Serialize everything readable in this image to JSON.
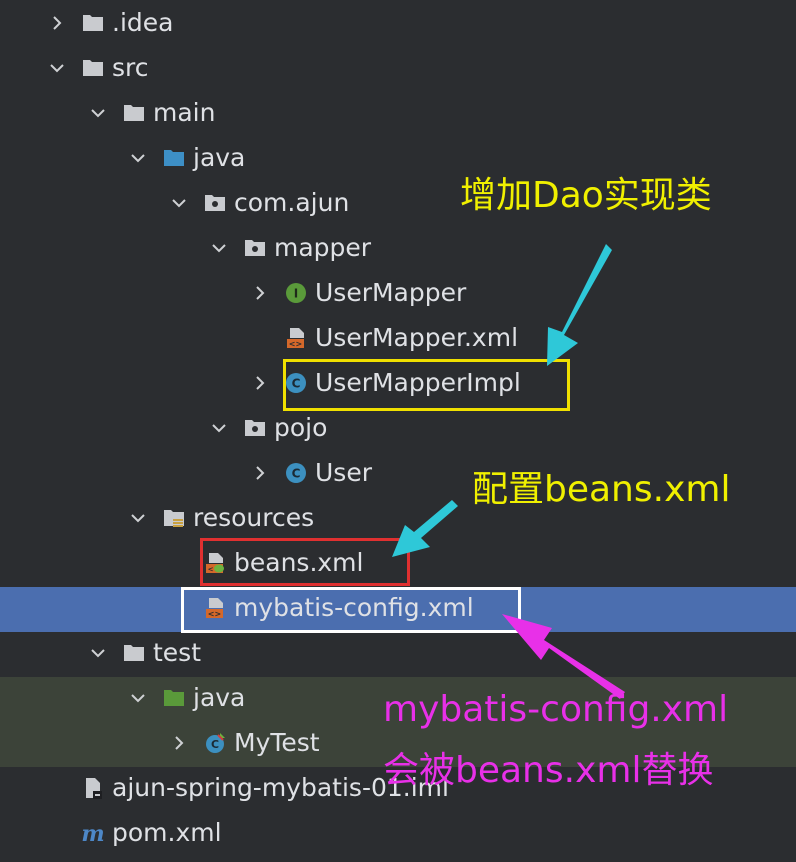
{
  "tree": {
    "idea": ".idea",
    "src": "src",
    "main": "main",
    "main_java": "java",
    "package": "com.ajun",
    "mapper": "mapper",
    "user_mapper": "UserMapper",
    "user_mapper_xml": "UserMapper.xml",
    "user_mapper_impl": "UserMapperImpl",
    "pojo": "pojo",
    "user": "User",
    "resources": "resources",
    "beans_xml": "beans.xml",
    "mybatis_config": "mybatis-config.xml",
    "test": "test",
    "test_java": "java",
    "my_test": "MyTest",
    "iml": "ajun-spring-mybatis-01.iml",
    "pom": "pom.xml"
  },
  "annotations": {
    "add_dao": "增加Dao实现类",
    "config_beans": "配置beans.xml",
    "replaced_line1": "mybatis-config.xml",
    "replaced_line2": "会被beans.xml替换"
  },
  "colors": {
    "background": "#2b2d30",
    "selection": "#4b6eaf",
    "test_highlight": "#3c4339",
    "annotation_yellow": "#f0f000",
    "annotation_magenta": "#e830e8",
    "arrow_cyan": "#2ec8d8",
    "box_yellow": "#f0e000",
    "box_red": "#e03030",
    "box_white": "#ffffff"
  }
}
